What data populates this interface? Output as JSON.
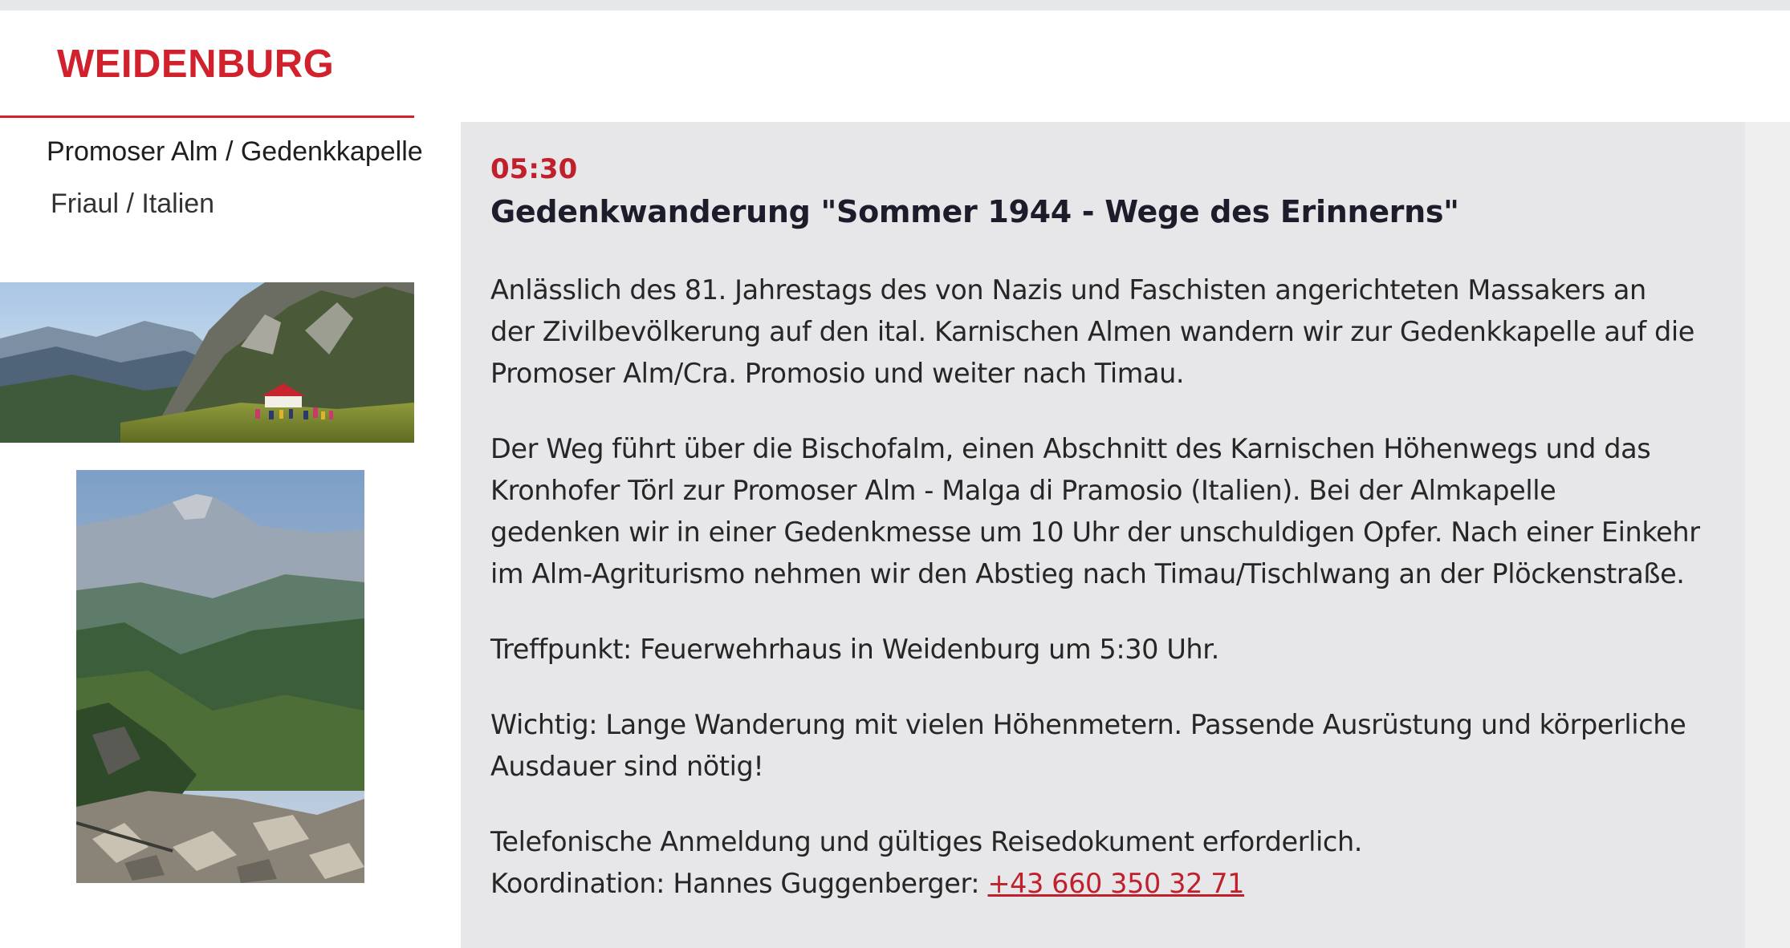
{
  "header": {
    "town": "WEIDENBURG"
  },
  "location": {
    "place": "Promoser Alm / Gedenkkapelle",
    "region": "Friaul / Italien"
  },
  "event": {
    "time": "05:30",
    "title": "Gedenkwanderung \"Sommer 1944 - Wege des Erinnerns\"",
    "paragraphs": {
      "intro": [
        "Anlässlich des 81. Jahrestags des von Nazis und Faschisten angerichteten Massakers an",
        "der Zivilbevölkerung auf den ital. Karnischen Almen wandern wir zur Gedenkkapelle auf die",
        "Promoser Alm/Cra. Promosio und weiter nach Timau."
      ],
      "route": [
        "Der Weg führt über die Bischofalm, einen Abschnitt des Karnischen Höhenwegs und das",
        "Kronhofer Törl zur Promoser Alm - Malga di Pramosio (Italien). Bei der Almkapelle",
        "gedenken wir in einer Gedenkmesse um 10 Uhr der unschuldigen Opfer. Nach einer Einkehr",
        "im Alm-Agriturismo nehmen wir den Abstieg nach Timau/Tischlwang an der Plöckenstraße."
      ],
      "meeting": [
        "Treffpunkt: Feuerwehrhaus in Weidenburg um 5:30 Uhr."
      ],
      "important": [
        "Wichtig: Lange Wanderung mit vielen Höhenmetern. Passende Ausrüstung und körperliche",
        "Ausdauer sind nötig!"
      ],
      "registration": "Telefonische Anmeldung und gültiges Reisedokument erforderlich.",
      "coordination_label": "Koordination: Hannes Guggenberger: ",
      "phone": "+43 660 350 32 71"
    }
  },
  "colors": {
    "accent": "#d0212d",
    "panel": "#e7e7e9",
    "text": "#262626"
  },
  "images": {
    "wide": "mountain-chapel-photo",
    "tall": "alpine-valley-photo"
  }
}
